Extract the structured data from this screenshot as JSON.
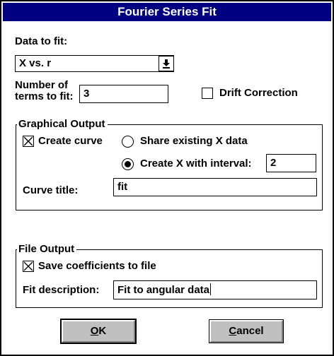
{
  "window": {
    "title": "Fourier Series Fit"
  },
  "data_section": {
    "label": "Data to fit:",
    "combo_value": "X vs. r"
  },
  "terms": {
    "label_line1": "Number of",
    "label_line2": "terms to fit:",
    "value": "3"
  },
  "drift": {
    "label": "Drift Correction",
    "checked": false
  },
  "graphical": {
    "group_label": "Graphical Output",
    "create_curve_label": "Create curve",
    "create_curve_checked": true,
    "share_label": "Share existing X data",
    "create_x_label": "Create X with interval:",
    "interval_value": "2",
    "selected_radio": "create_x",
    "curve_title_label": "Curve title:",
    "curve_title_value": "fit"
  },
  "file_output": {
    "group_label": "File Output",
    "save_label": "Save coefficients to file",
    "save_checked": true,
    "desc_label": "Fit description:",
    "desc_value": "Fit to angular data"
  },
  "buttons": {
    "ok_mnemonic": "O",
    "ok_rest": "K",
    "cancel_mnemonic": "C",
    "cancel_rest": "ancel"
  },
  "colors": {
    "titlebar": "#000080",
    "button_face": "#c0c0c0"
  }
}
